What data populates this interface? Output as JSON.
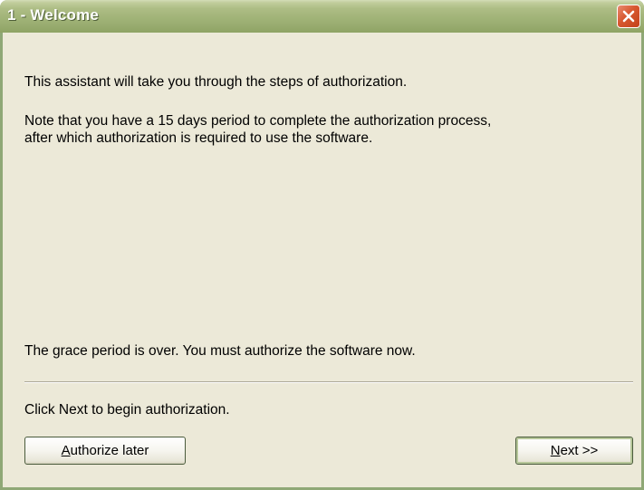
{
  "window": {
    "title": "1 - Welcome"
  },
  "body": {
    "intro": "This assistant will take you through the steps of authorization.",
    "note_line1": "Note that you have a 15 days period to complete the authorization process,",
    "note_line2": "after which authorization is required to use the software.",
    "grace_message": "The grace period is over. You must authorize the software now.",
    "instruction": "Click Next to begin authorization."
  },
  "buttons": {
    "later_accel": "A",
    "later_rest": "uthorize later",
    "next_accel": "N",
    "next_rest": "ext >>"
  },
  "icons": {
    "close": "close-icon"
  },
  "colors": {
    "titlebar": "#a3b57a",
    "close_button": "#d7572f",
    "background": "#ece9d8"
  }
}
